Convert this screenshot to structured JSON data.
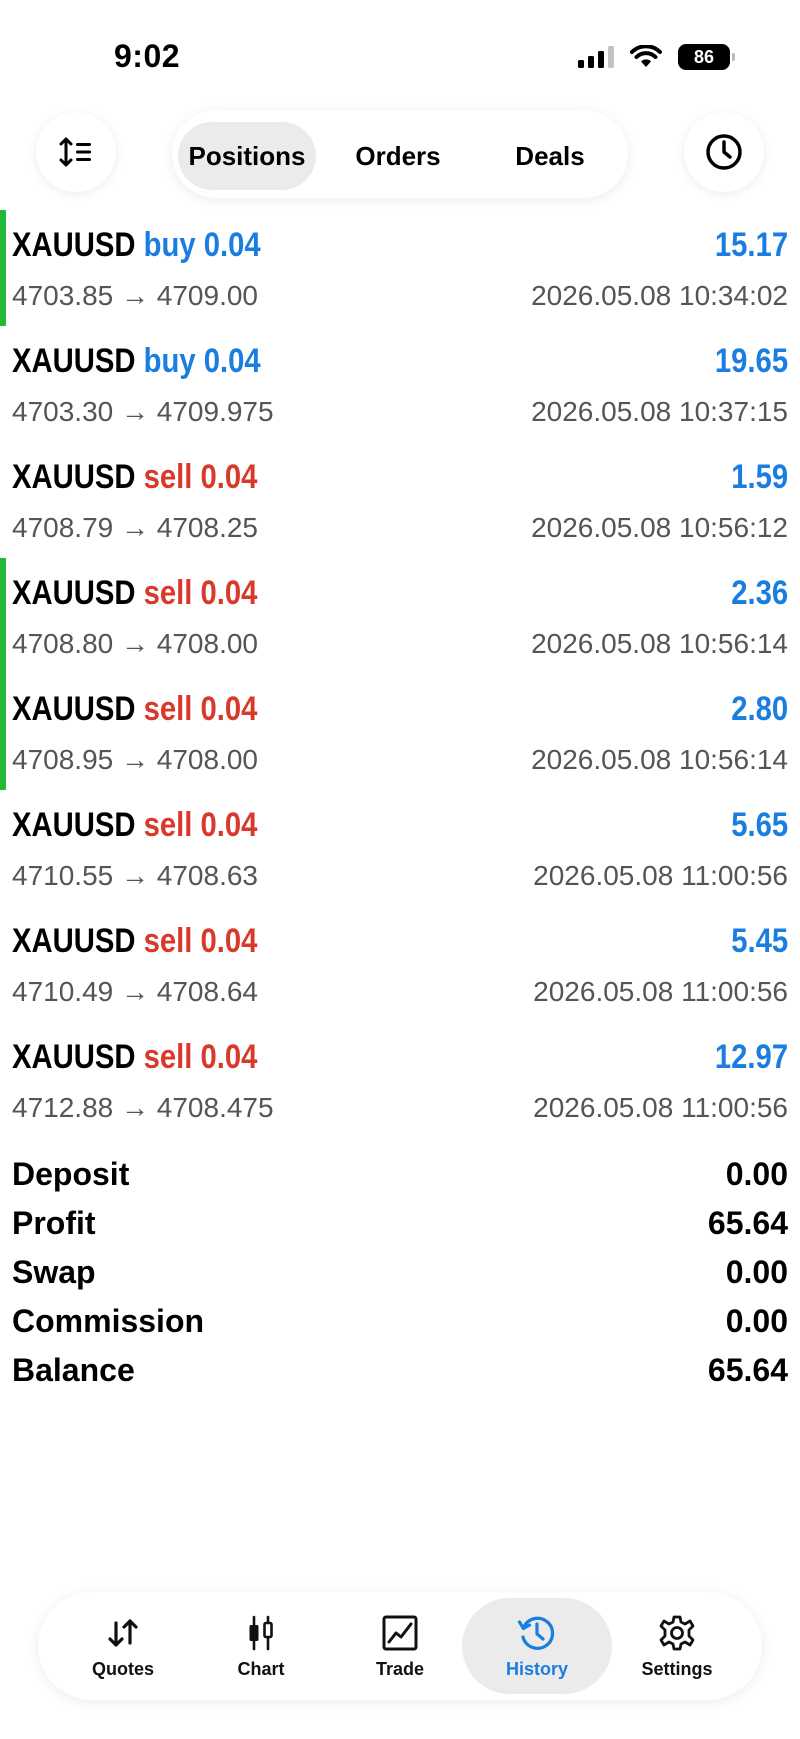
{
  "status_bar": {
    "time": "9:02",
    "battery": "86"
  },
  "top_bar": {
    "left_icon": "sort-icon",
    "right_icon": "clock-icon",
    "tabs": [
      {
        "label": "Positions",
        "active": true
      },
      {
        "label": "Orders",
        "active": false
      },
      {
        "label": "Deals",
        "active": false
      }
    ]
  },
  "trades": [
    {
      "symbol": "XAUUSD",
      "side": "buy",
      "volume": "0.04",
      "profit": "15.17",
      "open_price": "4703.85",
      "arrow": "→",
      "close_price": "4709.00",
      "time": "2026.05.08 10:34:02",
      "marker": true
    },
    {
      "symbol": "XAUUSD",
      "side": "buy",
      "volume": "0.04",
      "profit": "19.65",
      "open_price": "4703.30",
      "arrow": "→",
      "close_price": "4709.975",
      "time": "2026.05.08 10:37:15",
      "marker": false
    },
    {
      "symbol": "XAUUSD",
      "side": "sell",
      "volume": "0.04",
      "profit": "1.59",
      "open_price": "4708.79",
      "arrow": "→",
      "close_price": "4708.25",
      "time": "2026.05.08 10:56:12",
      "marker": false
    },
    {
      "symbol": "XAUUSD",
      "side": "sell",
      "volume": "0.04",
      "profit": "2.36",
      "open_price": "4708.80",
      "arrow": "→",
      "close_price": "4708.00",
      "time": "2026.05.08 10:56:14",
      "marker": true
    },
    {
      "symbol": "XAUUSD",
      "side": "sell",
      "volume": "0.04",
      "profit": "2.80",
      "open_price": "4708.95",
      "arrow": "→",
      "close_price": "4708.00",
      "time": "2026.05.08 10:56:14",
      "marker": true
    },
    {
      "symbol": "XAUUSD",
      "side": "sell",
      "volume": "0.04",
      "profit": "5.65",
      "open_price": "4710.55",
      "arrow": "→",
      "close_price": "4708.63",
      "time": "2026.05.08 11:00:56",
      "marker": false
    },
    {
      "symbol": "XAUUSD",
      "side": "sell",
      "volume": "0.04",
      "profit": "5.45",
      "open_price": "4710.49",
      "arrow": "→",
      "close_price": "4708.64",
      "time": "2026.05.08 11:00:56",
      "marker": false
    },
    {
      "symbol": "XAUUSD",
      "side": "sell",
      "volume": "0.04",
      "profit": "12.97",
      "open_price": "4712.88",
      "arrow": "→",
      "close_price": "4708.475",
      "time": "2026.05.08 11:00:56",
      "marker": false
    }
  ],
  "summary": [
    {
      "label": "Deposit",
      "value": "0.00"
    },
    {
      "label": "Profit",
      "value": "65.64"
    },
    {
      "label": "Swap",
      "value": "0.00"
    },
    {
      "label": "Commission",
      "value": "0.00"
    },
    {
      "label": "Balance",
      "value": "65.64"
    }
  ],
  "bottom_nav": [
    {
      "label": "Quotes",
      "icon": "quotes-arrows-icon",
      "active": false
    },
    {
      "label": "Chart",
      "icon": "candlestick-icon",
      "active": false
    },
    {
      "label": "Trade",
      "icon": "trade-chart-icon",
      "active": false
    },
    {
      "label": "History",
      "icon": "history-icon",
      "active": true
    },
    {
      "label": "Settings",
      "icon": "gear-icon",
      "active": false
    }
  ],
  "colors": {
    "buy": "#1a7de0",
    "sell": "#d8392b",
    "profit": "#1a7de0",
    "marker": "#22b83a",
    "active_nav": "#1a7de0"
  }
}
